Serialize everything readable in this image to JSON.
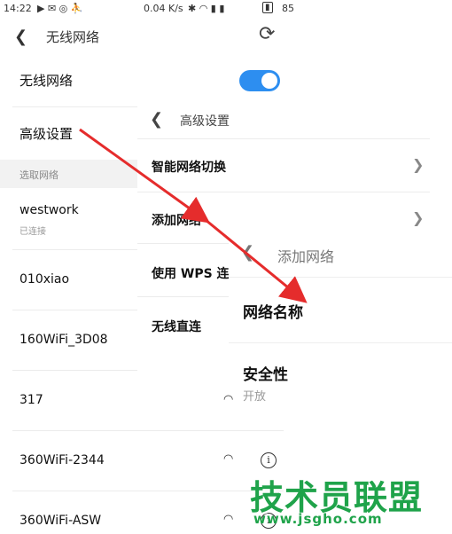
{
  "status_bar": {
    "time": "14:22",
    "left_icons": "▶ ✉ ◎ ⛹",
    "speed": "0.04 K/s",
    "right_icons": "✱ ◠ ▮ ▮",
    "battery": "85"
  },
  "layer1": {
    "title": "无线网络",
    "wifi_toggle_label": "无线网络",
    "advanced_label": "高级设置",
    "section_label": "选取网络",
    "networks": [
      {
        "name": "westwork",
        "status": "已连接"
      },
      {
        "name": "010xiao"
      },
      {
        "name": "160WiFi_3D08"
      },
      {
        "name": "317"
      },
      {
        "name": "360WiFi-2344"
      },
      {
        "name": "360WiFi-ASW"
      }
    ]
  },
  "layer2": {
    "title": "高级设置",
    "items": [
      "智能网络切换",
      "添加网络",
      "使用 WPS 连",
      "无线直连"
    ]
  },
  "layer3": {
    "title": "添加网络",
    "network_name_label": "网络名称",
    "security_label": "安全性",
    "security_value": "开放"
  },
  "watermark": {
    "line1": "技术员联盟",
    "line2": "www.jsgho.com"
  },
  "colors": {
    "accent": "#2d8ef0",
    "arrow": "#e52c2c",
    "watermark": "#1fa34a"
  }
}
